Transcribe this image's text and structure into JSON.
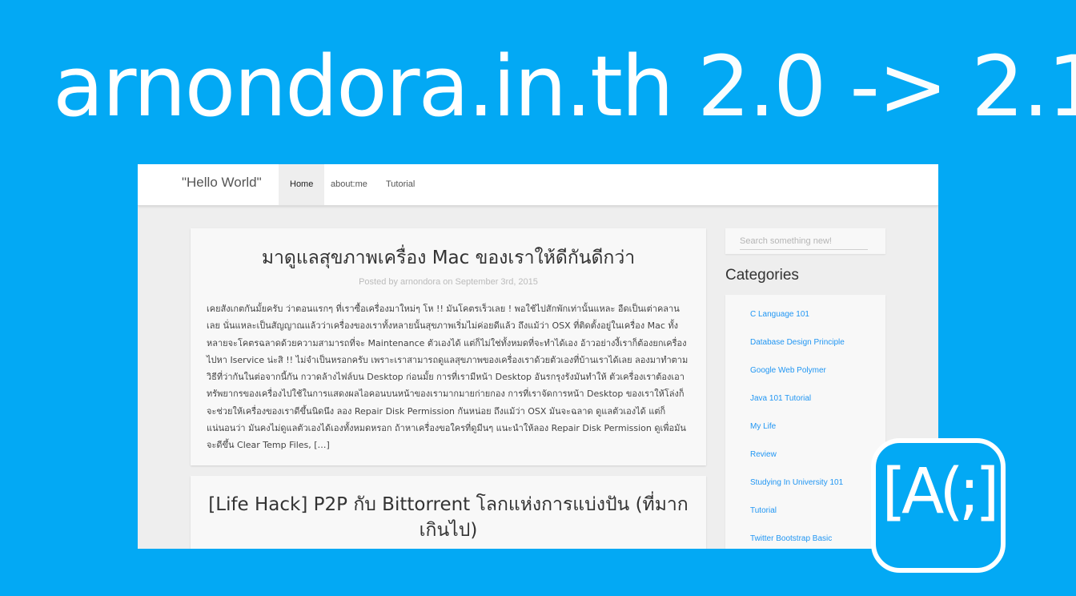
{
  "banner": {
    "site": "arnondora.in.th",
    "version": "2.0 -> 2.1"
  },
  "navbar": {
    "brand": "\"Hello World\"",
    "items": [
      {
        "label": "Home",
        "active": true
      },
      {
        "label": "about:me",
        "active": false
      },
      {
        "label": "Tutorial",
        "active": false
      }
    ]
  },
  "posts": [
    {
      "title": "มาดูแลสุขภาพเครื่อง Mac ของเราให้ดีกันดีกว่า",
      "meta": "Posted by arnondora on September 3rd, 2015",
      "excerpt": "เคยสังเกตกันมั้ยครับ ว่าตอนแรกๆ ที่เราซื้อเครื่องมาใหม่ๆ โห !! มันโคตรเร็วเลย ! พอใช้ไปสักพักเท่านั้นแหละ อืดเป็นเต่าคลานเลย นั่นแหละเป็นสัญญาณแล้วว่าเครื่องของเราทั้งหลายนั้นสุขภาพเริ่มไม่ค่อยดีแล้ว ถึงแม้ว่า OSX ที่ติดตั้งอยู่ในเครื่อง Mac ทั้งหลายจะโคตรฉลาดด้วยความสามารถที่จะ Maintenance ตัวเองได้ แต่ก็ไม่ใช่ทั้งหมดที่จะทำได้เอง อ้าวอย่างงี้เราก็ต้องยกเครื่องไปหา Iservice น่ะสิ !! ไม่จำเป็นหรอกครับ เพราะเราสามารถดูแลสุขภาพของเครื่องเราด้วยตัวเองที่บ้านเราได้เลย ลองมาทำตามวิธีที่ว่ากันในต่อจากนี้กัน กวาดล้างไฟล์บน Desktop ก่อนมั้ย การที่เรามีหน้า Desktop อันรกรุงรังมันทำให้ ตัวเครื่องเราต้องเอาทรัพยากรของเครื่องไปใช้ในการแสดงผลไอคอนบนหน้าของเรามากมายก่ายกอง การที่เราจัดการหน้า Desktop ของเราให้โล่งก็จะช่วยให้เครื่องของเราดีขึ้นนิดนึง ลอง Repair Disk Permission กันหน่อย ถึงแม้ว่า OSX มันจะฉลาด ดูแลตัวเองได้ แต่ก็แน่นอนว่า มันคงไม่ดูแลตัวเองได้เองทั้งหมดหรอก ถ้าหาเครื่องขอใครที่ดูมีนๆ แนะนำให้ลอง Repair Disk Permission ดูเพื่อมันจะดีขึ้น Clear Temp Files, […]"
    },
    {
      "title": "[Life Hack] P2P กับ Bittorrent โลกแห่งการแบ่งปัน (ที่มากเกินไป)"
    }
  ],
  "sidebar": {
    "search_placeholder": "Search something new!",
    "categories_heading": "Categories",
    "categories": [
      "C Language 101",
      "Database Design Principle",
      "Google Web Polymer",
      "Java 101 Tutorial",
      "My Life",
      "Review",
      "Studying In University 101",
      "Tutorial",
      "Twitter Bootstrap Basic"
    ]
  },
  "logo": {
    "text": "[A(;]"
  },
  "colors": {
    "background": "#03a9f4",
    "link": "#2196f3",
    "page": "#eeeeee",
    "card": "#f8f8f8"
  }
}
